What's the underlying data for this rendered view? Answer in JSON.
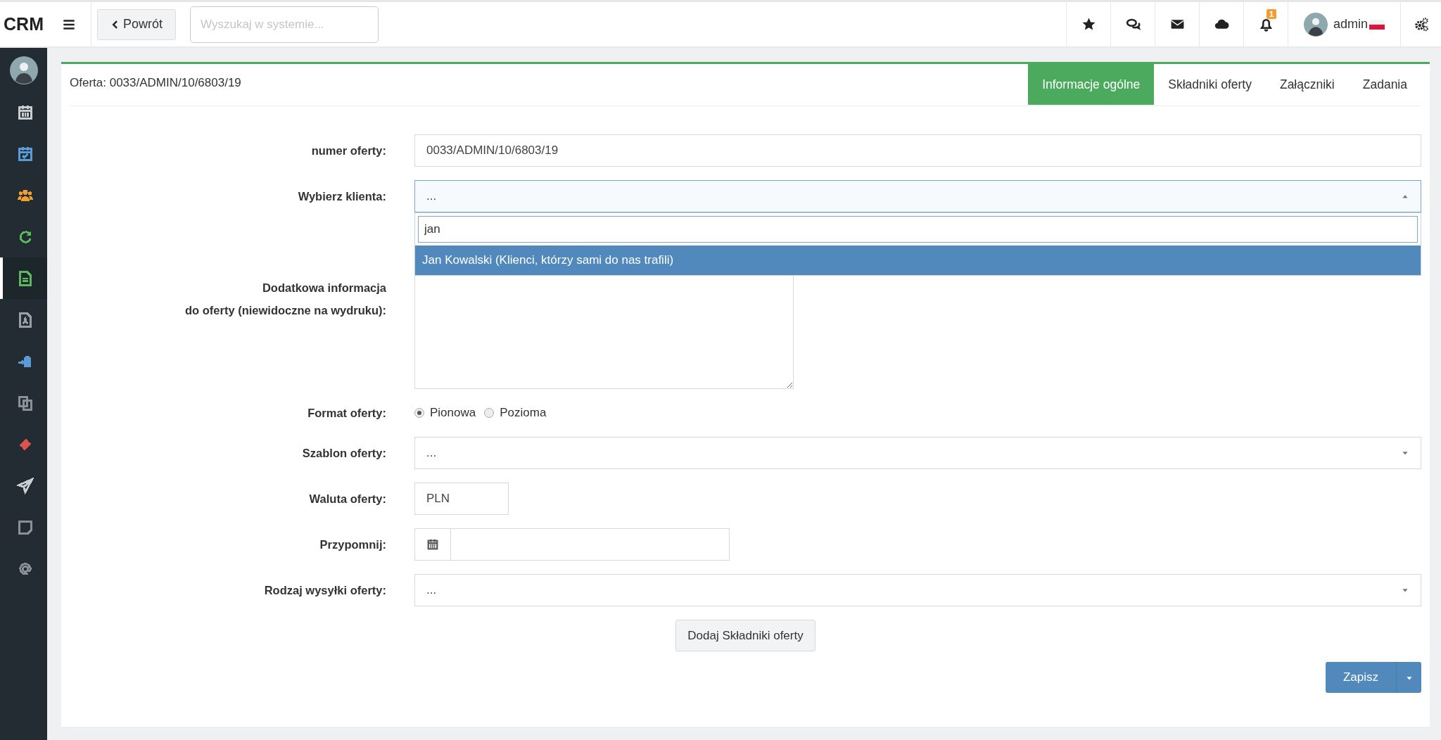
{
  "topbar": {
    "brand": "CRM",
    "back_button": "Powrót",
    "search": {
      "placeholder": "Wyszukaj w systemie..."
    },
    "notifications_badge": "1",
    "user": "admin"
  },
  "sidebar": {
    "items": [
      {
        "selected": false,
        "color": "#c9cdd1"
      },
      {
        "selected": false,
        "color": "#5a9bd5"
      },
      {
        "selected": false,
        "color": "#f0a030"
      },
      {
        "selected": false,
        "color": "#5cb85c"
      },
      {
        "selected": true,
        "color": "#5cb85c"
      },
      {
        "selected": false,
        "color": "#9aa0a6"
      },
      {
        "selected": false,
        "color": "#5a9bd5"
      },
      {
        "selected": false,
        "color": "#8a9096"
      },
      {
        "selected": false,
        "color": "#d9534f"
      },
      {
        "selected": false,
        "color": "#c9cdd1"
      },
      {
        "selected": false,
        "color": "#8a9096"
      },
      {
        "selected": false,
        "color": "#8a9096"
      }
    ]
  },
  "card": {
    "title": "Oferta: 0033/ADMIN/10/6803/19",
    "tabs": [
      {
        "label": "Informacje ogólne",
        "selected": true
      },
      {
        "label": "Składniki oferty",
        "selected": false
      },
      {
        "label": "Załączniki",
        "selected": false
      },
      {
        "label": "Zadania",
        "selected": false
      }
    ]
  },
  "form": {
    "fields": [
      {
        "kind": "text",
        "label": "numer oferty:",
        "value": "0033/ADMIN/10/6803/19"
      },
      {
        "kind": "select",
        "label": "Wybierz klienta:",
        "value": "...",
        "expanded": true,
        "search_value": "jan",
        "options": [
          {
            "label": "Jan Kowalski (Klienci, którzy sami do nas trafili)",
            "selected": true
          }
        ]
      },
      {
        "kind": "textarea",
        "label_lines": [
          "Dodatkowa informacja",
          "do oferty (niewidoczne na wydruku):"
        ]
      },
      {
        "kind": "radio",
        "label": "Format oferty:",
        "options": [
          {
            "label": "Pionowa",
            "selected": true
          },
          {
            "label": "Pozioma",
            "selected": false
          }
        ]
      },
      {
        "kind": "select",
        "label": "Szablon oferty:",
        "value": "...",
        "expanded": false
      },
      {
        "kind": "currency",
        "label": "Waluta oferty:",
        "value": "PLN"
      },
      {
        "kind": "date",
        "label": "Przypomnij:"
      },
      {
        "kind": "select",
        "label": "Rodzaj wysyłki oferty:",
        "value": "...",
        "expanded": false
      }
    ],
    "add_button": "Dodaj Składniki oferty",
    "save_button": "Zapisz"
  }
}
